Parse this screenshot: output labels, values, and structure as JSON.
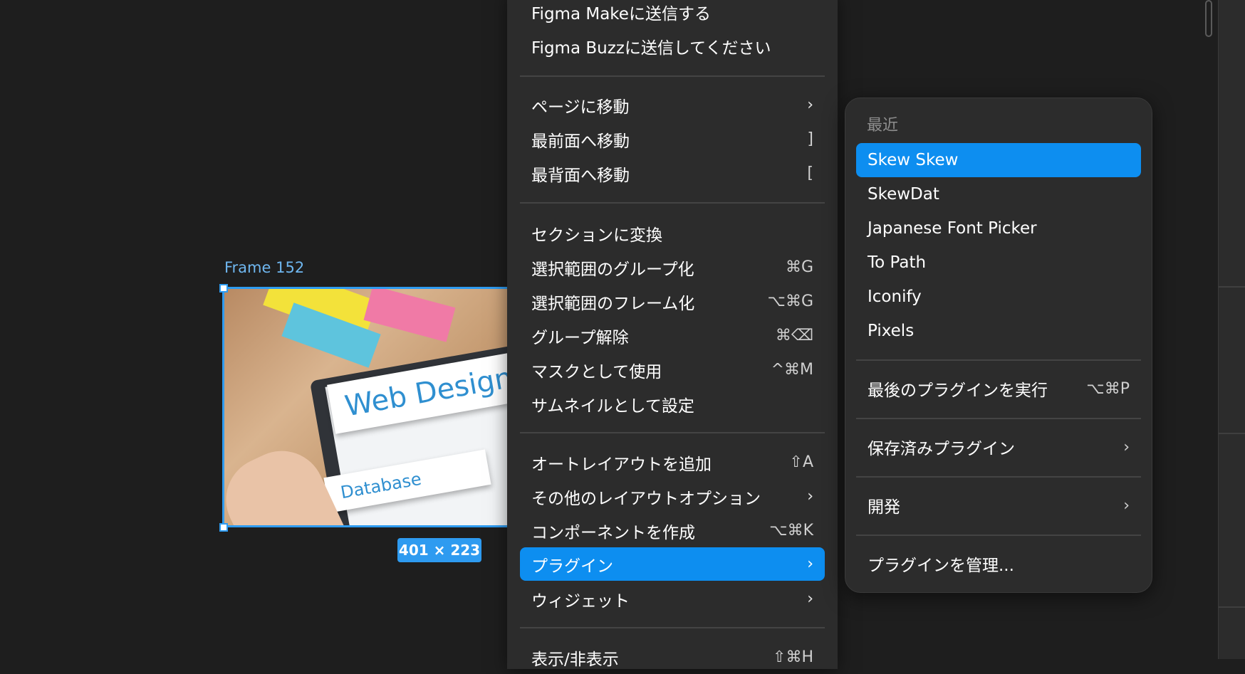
{
  "canvas": {
    "frame_label": "Frame 152",
    "dimensions": "401 × 223",
    "image_text_1": "Web Design",
    "image_text_2": "Database"
  },
  "context_menu": {
    "items": [
      {
        "label": "Figma Makeに送信する",
        "shortcut": "",
        "submenu": false
      },
      {
        "label": "Figma Buzzに送信してください",
        "shortcut": "",
        "submenu": false
      },
      {
        "label": "ページに移動",
        "shortcut": "",
        "submenu": true
      },
      {
        "label": "最前面へ移動",
        "shortcut": "]",
        "submenu": false
      },
      {
        "label": "最背面へ移動",
        "shortcut": "[",
        "submenu": false
      },
      {
        "label": "セクションに変換",
        "shortcut": "",
        "submenu": false
      },
      {
        "label": "選択範囲のグループ化",
        "shortcut": "⌘G",
        "submenu": false
      },
      {
        "label": "選択範囲のフレーム化",
        "shortcut": "⌥⌘G",
        "submenu": false
      },
      {
        "label": "グループ解除",
        "shortcut": "⌘⌫",
        "submenu": false
      },
      {
        "label": "マスクとして使用",
        "shortcut": "^⌘M",
        "submenu": false
      },
      {
        "label": "サムネイルとして設定",
        "shortcut": "",
        "submenu": false
      },
      {
        "label": "オートレイアウトを追加",
        "shortcut": "⇧A",
        "submenu": false
      },
      {
        "label": "その他のレイアウトオプション",
        "shortcut": "",
        "submenu": true
      },
      {
        "label": "コンポーネントを作成",
        "shortcut": "⌥⌘K",
        "submenu": false
      },
      {
        "label": "プラグイン",
        "shortcut": "",
        "submenu": true,
        "active": true
      },
      {
        "label": "ウィジェット",
        "shortcut": "",
        "submenu": true
      },
      {
        "label": "表示/非表示",
        "shortcut": "⇧⌘H",
        "submenu": false
      }
    ],
    "arrow": "›"
  },
  "plugin_submenu": {
    "recent_header": "最近",
    "recent": [
      "Skew Skew",
      "SkewDat",
      "Japanese Font Picker",
      "To Path",
      "Iconify",
      "Pixels"
    ],
    "run_last": {
      "label": "最後のプラグインを実行",
      "shortcut": "⌥⌘P"
    },
    "saved": "保存済みプラグイン",
    "development": "開発",
    "manage": "プラグインを管理..."
  },
  "colors": {
    "accent": "#0d8ef0",
    "selection": "#2e9bf0",
    "menu_bg": "#2c2c2c",
    "canvas_bg": "#1e1e1e"
  }
}
